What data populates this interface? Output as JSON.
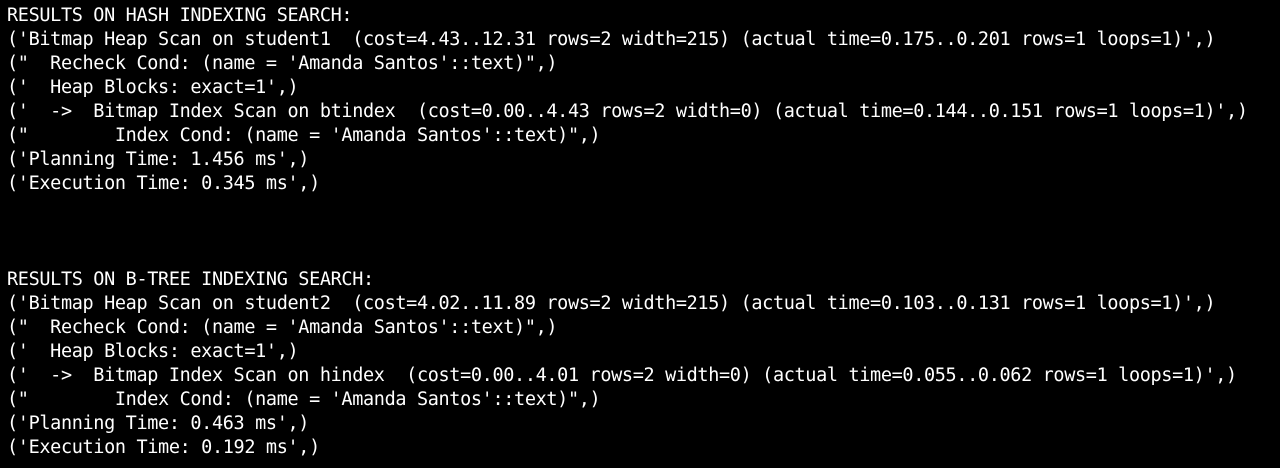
{
  "terminal": {
    "background": "#000000",
    "foreground": "#ffffff",
    "hash_block": {
      "heading": "RESULTS ON HASH INDEXING SEARCH:",
      "lines": [
        "('Bitmap Heap Scan on student1  (cost=4.43..12.31 rows=2 width=215) (actual time=0.175..0.201 rows=1 loops=1)',)",
        "(\"  Recheck Cond: (name = 'Amanda Santos'::text)\",)",
        "('  Heap Blocks: exact=1',)",
        "('  ->  Bitmap Index Scan on btindex  (cost=0.00..4.43 rows=2 width=0) (actual time=0.144..0.151 rows=1 loops=1)',)",
        "(\"        Index Cond: (name = 'Amanda Santos'::text)\",)",
        "('Planning Time: 1.456 ms',)",
        "('Execution Time: 0.345 ms',)"
      ]
    },
    "btree_block": {
      "heading": "RESULTS ON B-TREE INDEXING SEARCH:",
      "lines": [
        "('Bitmap Heap Scan on student2  (cost=4.02..11.89 rows=2 width=215) (actual time=0.103..0.131 rows=1 loops=1)',)",
        "(\"  Recheck Cond: (name = 'Amanda Santos'::text)\",)",
        "('  Heap Blocks: exact=1',)",
        "('  ->  Bitmap Index Scan on hindex  (cost=0.00..4.01 rows=2 width=0) (actual time=0.055..0.062 rows=1 loops=1)',)",
        "(\"        Index Cond: (name = 'Amanda Santos'::text)\",)",
        "('Planning Time: 0.463 ms',)",
        "('Execution Time: 0.192 ms',)"
      ]
    }
  }
}
